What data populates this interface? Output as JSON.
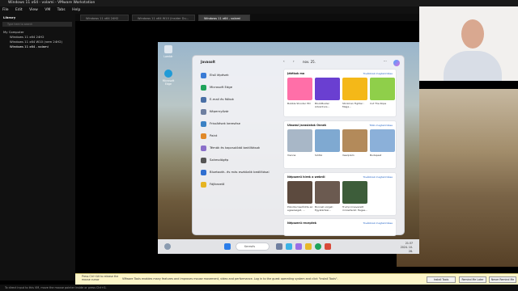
{
  "window": {
    "title": "Windows 11 x64 - volami - VMware Workstation"
  },
  "menu": [
    "File",
    "Edit",
    "View",
    "VM",
    "Tabs",
    "Help"
  ],
  "tabs": [
    {
      "label": "Windows 11 x64 24H2"
    },
    {
      "label": "Windows 11 x64 W10 (Insider Du..."
    },
    {
      "label": "Windows 11 x64 - volami"
    }
  ],
  "library": {
    "title": "Library",
    "search_placeholder": "Type here to search",
    "tree": [
      "My Computer",
      "Windows 11 x64 24H2",
      "Windows 11 x64 W10 (nem 24H2)",
      "Windows 11 x64 - volami"
    ]
  },
  "desktop": {
    "icons": [
      {
        "label": "Lomtár"
      },
      {
        "label": "Microsoft Edge"
      }
    ]
  },
  "start_menu": {
    "left_title": "Javasolt",
    "items": [
      {
        "label": "Első lépések",
        "icon": "compass-icon",
        "color": "#3a7bd5"
      },
      {
        "label": "Microsoft Edge",
        "icon": "edge-icon",
        "color": "#1fa35a"
      },
      {
        "label": "E-mail és fiókok",
        "icon": "mail-icon",
        "color": "#4a6fa5"
      },
      {
        "label": "Képernyőzár",
        "icon": "lock-icon",
        "color": "#6e7fa0"
      },
      {
        "label": "Frissítések keresése",
        "icon": "sync-icon",
        "color": "#3b82c4"
      },
      {
        "label": "Paint",
        "icon": "paint-icon",
        "color": "#e0892a"
      },
      {
        "label": "Témák és kapcsolódó beállítások",
        "icon": "brush-icon",
        "color": "#8a6fc9"
      },
      {
        "label": "Számológép",
        "icon": "calculator-icon",
        "color": "#555"
      },
      {
        "label": "Bluetooth- és más eszközök beállításai",
        "icon": "bluetooth-icon",
        "color": "#2f6fd0"
      },
      {
        "label": "Fájlkezelő",
        "icon": "folder-icon",
        "color": "#e6b422"
      }
    ],
    "date": "nov. 25.",
    "cards": [
      {
        "title": "Játékok ma",
        "more": "Továbbiak megtekintése",
        "tiles": [
          {
            "label": "Bubble Shooter HD",
            "color": "#ff6fa8"
          },
          {
            "label": "BlockBuster Adventure...",
            "color": "#6a3fd1"
          },
          {
            "label": "Stickman Fighter : Mega...",
            "color": "#f4b818"
          },
          {
            "label": "Cut The Rope",
            "color": "#8fcf4a"
          }
        ]
      },
      {
        "title": "Utazási javaslatok Önnek",
        "more": "Több megtekintése",
        "tiles": [
          {
            "label": "Vienna",
            "color": "#a8b7c7"
          },
          {
            "label": "Siófok",
            "color": "#7fa9d1"
          },
          {
            "label": "Veszprém",
            "color": "#b38a5a"
          },
          {
            "label": "Budapest",
            "color": "#8bb0d9"
          }
        ]
      },
      {
        "title": "Népszerű hírek a webről",
        "more": "Továbbiak megtekintése",
        "tiles": [
          {
            "label": "Pokolba taszította az egészségét, ...",
            "color": "#5c4a3e"
          },
          {
            "label": "Bonnell sürget: Egyetértési...",
            "color": "#6b5a50"
          },
          {
            "label": "Trump kinevezett miniszterét: Hegse...",
            "color": "#3d5d3a"
          }
        ]
      },
      {
        "title": "Népszerű receptek",
        "more": "Továbbiak megtekintése",
        "tiles": []
      }
    ]
  },
  "taskbar": {
    "search_placeholder": "Keresés",
    "time": "21:37",
    "date": "2024. 10. 28."
  },
  "hint": {
    "left": "Press Ctrl+Alt to release the mouse cursor",
    "main": "VMware Tools enables many features and improves mouse movement, video and performance. Log in to the guest operating system and click \"Install Tools\".",
    "buttons": [
      "Install Tools",
      "Remind Me Later",
      "Never Remind Me"
    ]
  },
  "status": "To direct input to this VM, move the mouse pointer inside or press Ctrl+G."
}
